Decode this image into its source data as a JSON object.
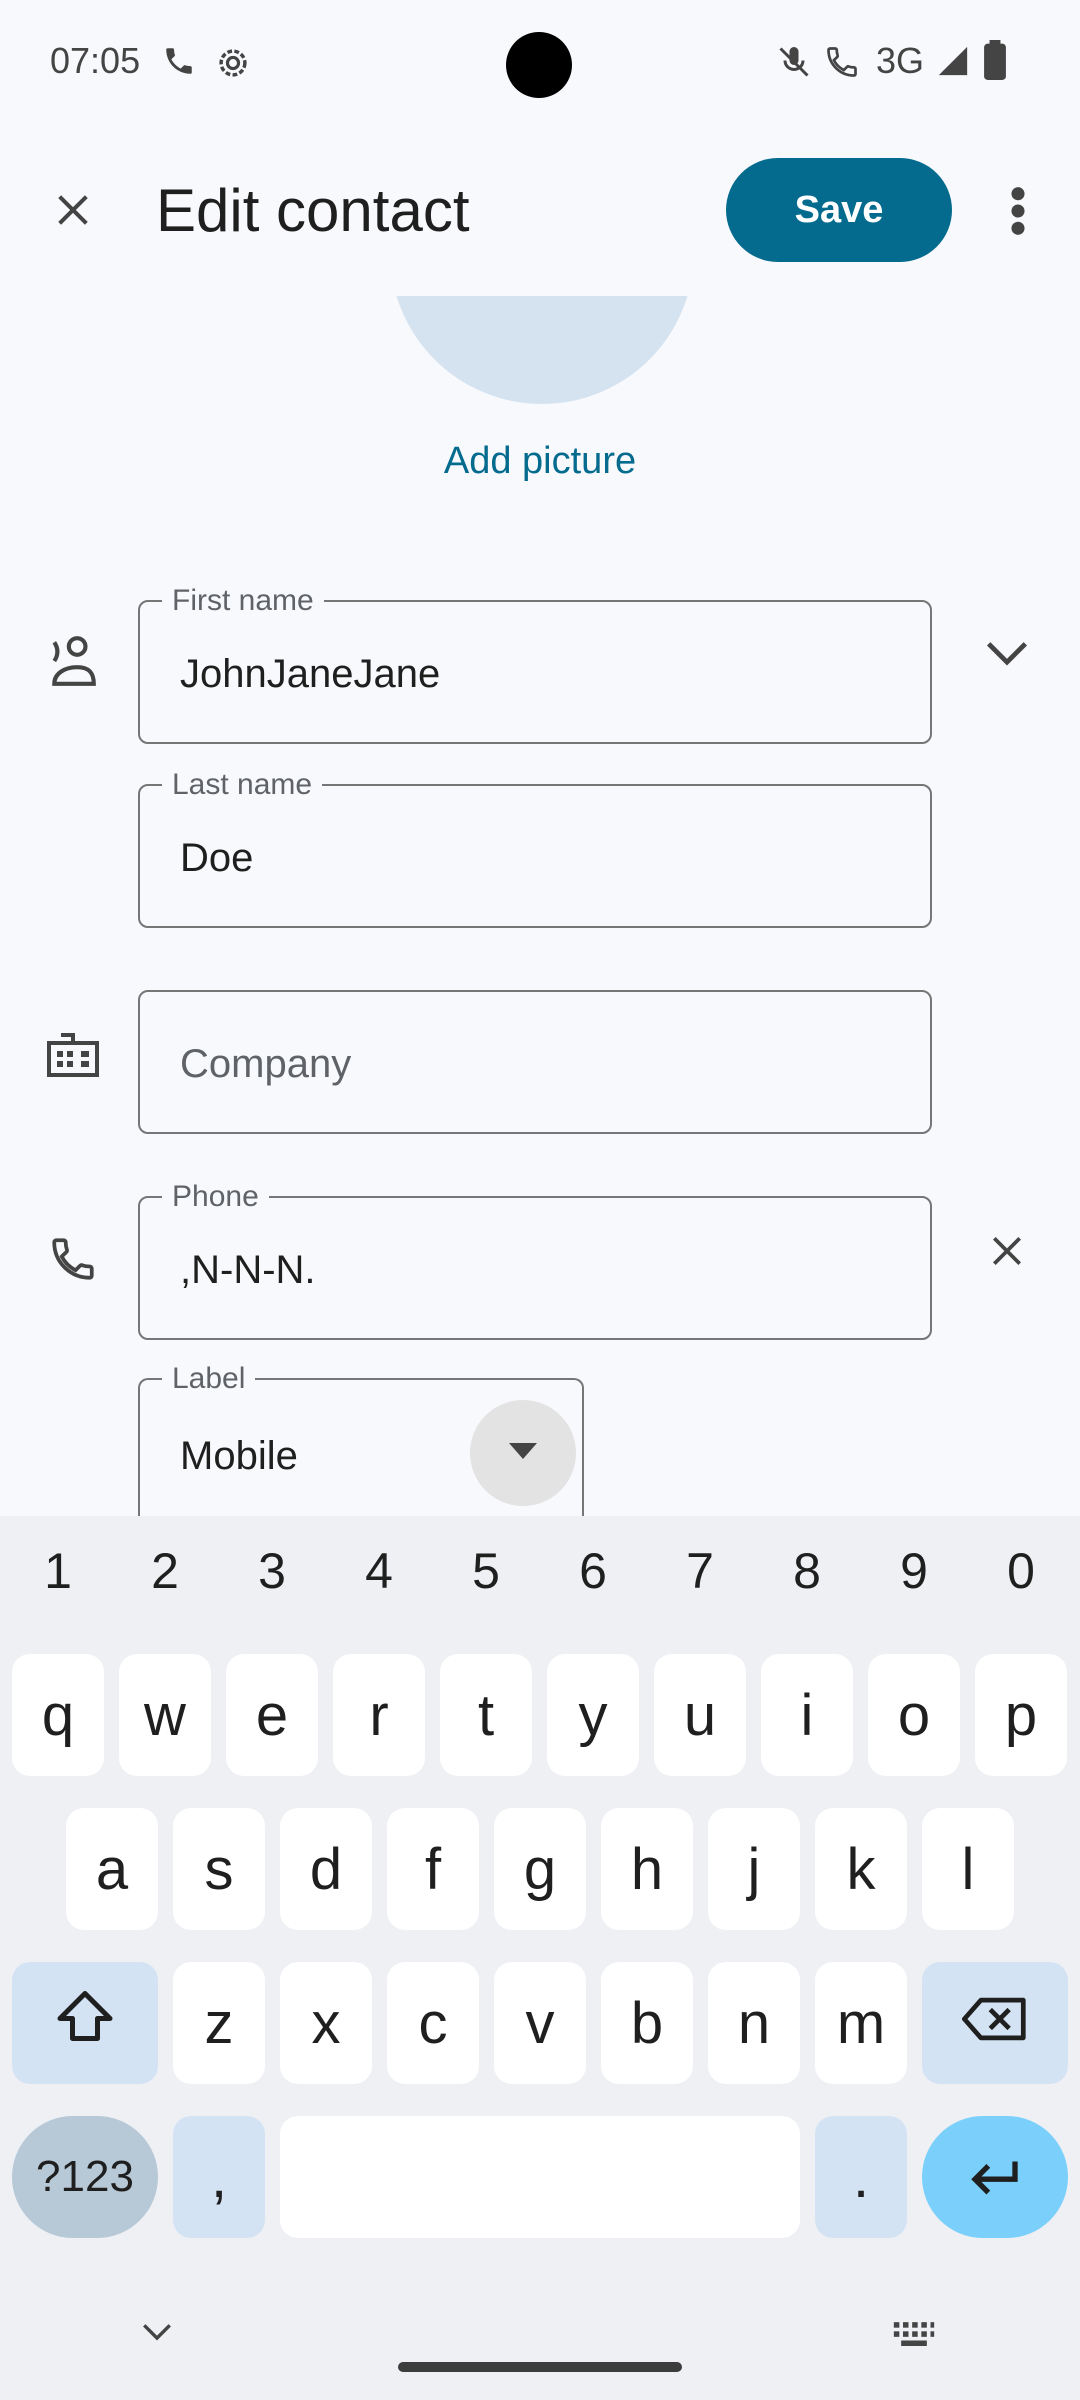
{
  "status_bar": {
    "time": "07:05",
    "network": "3G",
    "icons": [
      "phone-icon",
      "settings-icon",
      "mute-icon",
      "wifi-call-icon",
      "signal-icon",
      "battery-icon"
    ]
  },
  "app_bar": {
    "title": "Edit contact",
    "save_label": "Save",
    "close_icon": "close-icon",
    "more_icon": "more-vert-icon"
  },
  "photo": {
    "add_picture_label": "Add picture"
  },
  "name_section": {
    "first_name_label": "First name",
    "first_name_value": "JohnJaneJane",
    "last_name_label": "Last name",
    "last_name_value": "Doe"
  },
  "company": {
    "placeholder": "Company"
  },
  "phone_section": {
    "phone_label": "Phone",
    "phone_value": ",N-N-N.",
    "type_label": "Label",
    "type_value": "Mobile"
  },
  "keyboard": {
    "numbers": [
      "1",
      "2",
      "3",
      "4",
      "5",
      "6",
      "7",
      "8",
      "9",
      "0"
    ],
    "row1": [
      "q",
      "w",
      "e",
      "r",
      "t",
      "y",
      "u",
      "i",
      "o",
      "p"
    ],
    "row2": [
      "a",
      "s",
      "d",
      "f",
      "g",
      "h",
      "j",
      "k",
      "l"
    ],
    "row3": [
      "z",
      "x",
      "c",
      "v",
      "b",
      "n",
      "m"
    ],
    "symbols_label": "?123",
    "comma_label": ",",
    "period_label": "."
  },
  "colors": {
    "accent": "#046b8f",
    "enter_key": "#7ad0fa",
    "avatar_bg": "#d5e3f1"
  }
}
